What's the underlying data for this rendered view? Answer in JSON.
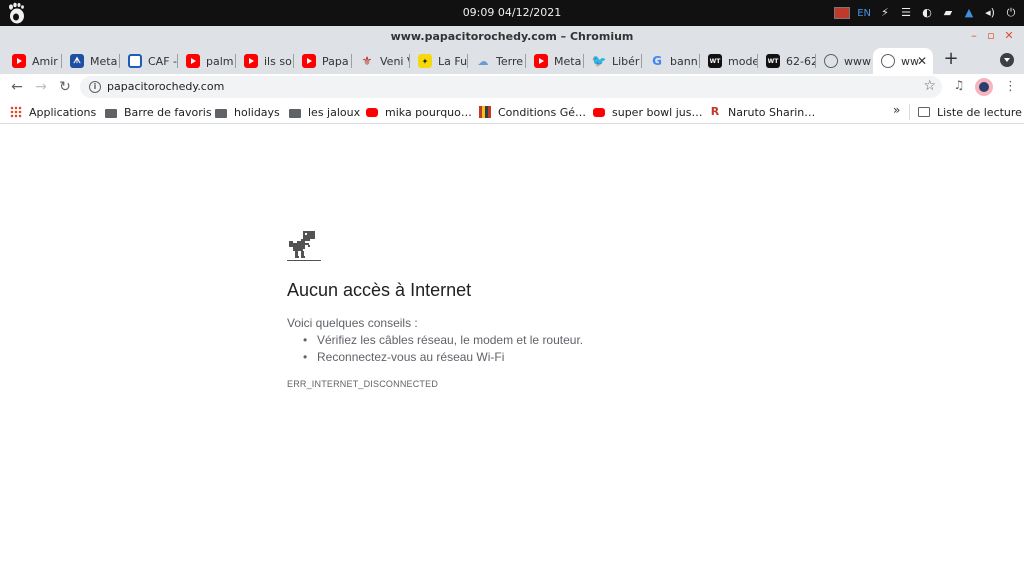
{
  "system_bar": {
    "clock": "09:09 04/12/2021",
    "keyboard_lang": "EN",
    "icons": [
      "gnome-foot-icon",
      "flag-icon",
      "network-off-icon",
      "menu-icon",
      "night-mode-icon",
      "folder-icon",
      "notification-icon",
      "volume-icon",
      "power-icon"
    ]
  },
  "window": {
    "title": "www.papacitorochedy.com – Chromium"
  },
  "tabs": [
    {
      "label": "Amir",
      "icon": "youtube-icon"
    },
    {
      "label": "Meta",
      "icon": "meta-icon"
    },
    {
      "label": "CAF -",
      "icon": "caf-icon"
    },
    {
      "label": "palm",
      "icon": "youtube-icon"
    },
    {
      "label": "ils so",
      "icon": "youtube-icon"
    },
    {
      "label": "Papa",
      "icon": "youtube-icon"
    },
    {
      "label": "Veni V",
      "icon": "fleur-de-lis-icon"
    },
    {
      "label": "La Fu",
      "icon": "yellow-logo-icon"
    },
    {
      "label": "Terre",
      "icon": "cloud-icon"
    },
    {
      "label": "Meta",
      "icon": "youtube-icon"
    },
    {
      "label": "Libér",
      "icon": "twitter-icon"
    },
    {
      "label": "bann",
      "icon": "google-icon"
    },
    {
      "label": "mode",
      "icon": "wt-icon"
    },
    {
      "label": "62-62",
      "icon": "wt-icon"
    },
    {
      "label": "www",
      "icon": "globe-icon"
    },
    {
      "label": "ww",
      "icon": "globe-icon",
      "active": true
    }
  ],
  "toolbar": {
    "url": "papacitorochedy.com"
  },
  "bookmarks": [
    {
      "label": "Applications",
      "icon": "apps-grid-icon"
    },
    {
      "label": "Barre de favoris",
      "icon": "folder-icon"
    },
    {
      "label": "holidays",
      "icon": "folder-icon"
    },
    {
      "label": "les jaloux",
      "icon": "folder-icon"
    },
    {
      "label": "mika pourquo…",
      "icon": "youtube-icon"
    },
    {
      "label": "Conditions Gé…",
      "icon": "stripes-icon"
    },
    {
      "label": "super bowl jus…",
      "icon": "youtube-icon"
    },
    {
      "label": "Naruto Sharin…",
      "icon": "r-logo-icon"
    }
  ],
  "bookmarks_more": "»",
  "reading_list": "Liste de lecture",
  "error_page": {
    "title": "Aucun accès à Internet",
    "subtitle": "Voici quelques conseils :",
    "tips": [
      "Vérifiez les câbles réseau, le modem et le routeur.",
      "Reconnectez-vous au réseau Wi-Fi"
    ],
    "code": "ERR_INTERNET_DISCONNECTED"
  }
}
